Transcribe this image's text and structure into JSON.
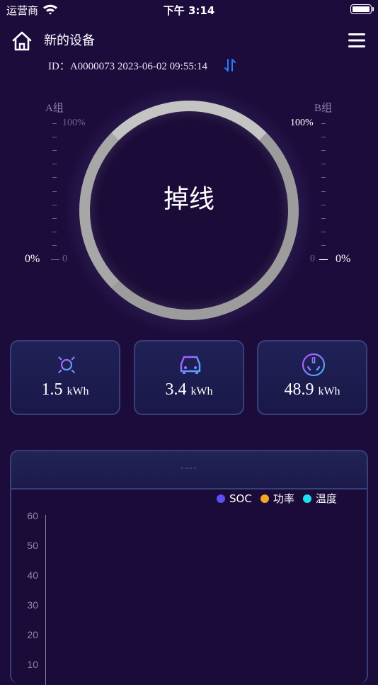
{
  "status_bar": {
    "carrier": "运营商",
    "time": "下午 3:14"
  },
  "header": {
    "title": "新的设备",
    "id_line": "ID：A0000073  2023-06-02 09:55:14"
  },
  "gauge": {
    "status": "掉线",
    "group_a": {
      "label": "A组",
      "top_value": "100%",
      "bottom_tick": "0",
      "percent": "0%"
    },
    "group_b": {
      "label": "B组",
      "top_value": "100%",
      "bottom_tick": "0",
      "percent": "0%"
    }
  },
  "cards": [
    {
      "icon": "sun-icon",
      "value": "1.5",
      "unit": "kWh"
    },
    {
      "icon": "car-icon",
      "value": "3.4",
      "unit": "kWh"
    },
    {
      "icon": "socket-icon",
      "value": "48.9",
      "unit": "kWh"
    }
  ],
  "chart": {
    "title": "----",
    "legend": [
      {
        "name": "SOC",
        "color": "#5b4ff0"
      },
      {
        "name": "功率",
        "color": "#f5a623"
      },
      {
        "name": "温度",
        "color": "#1ee0f0"
      }
    ],
    "y_ticks": [
      "60",
      "50",
      "40",
      "30",
      "20",
      "10"
    ]
  },
  "chart_data": {
    "type": "line",
    "series": [
      {
        "name": "SOC",
        "values": []
      },
      {
        "name": "功率",
        "values": []
      },
      {
        "name": "温度",
        "values": []
      }
    ],
    "y_ticks": [
      60,
      50,
      40,
      30,
      20,
      10
    ],
    "ylim": [
      0,
      60
    ],
    "legend_position": "top-right"
  },
  "colors": {
    "background": "#1c0c3c",
    "card_border": "#3a3f7a",
    "accent_blue": "#2a7bff"
  }
}
